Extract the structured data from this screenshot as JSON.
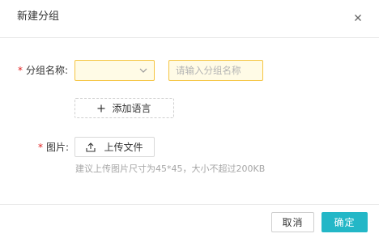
{
  "dialog": {
    "title": "新建分组",
    "close_icon": "close-icon"
  },
  "form": {
    "group_name": {
      "required_mark": "*",
      "label": "分组名称:",
      "select_value": "",
      "input_placeholder": "请输入分组名称",
      "input_value": ""
    },
    "add_language": {
      "icon": "plus-icon",
      "label": "添加语言"
    },
    "image": {
      "required_mark": "*",
      "label": "图片:",
      "upload_icon": "upload-icon",
      "upload_label": "上传文件",
      "hint": "建议上传图片尺寸为45*45，大小不超过200KB"
    }
  },
  "footer": {
    "cancel_label": "取消",
    "ok_label": "确定"
  },
  "colors": {
    "accent": "#23b7c7",
    "warning_border": "#f5c542",
    "warning_bg": "#fffbe6",
    "required": "#e02020"
  }
}
